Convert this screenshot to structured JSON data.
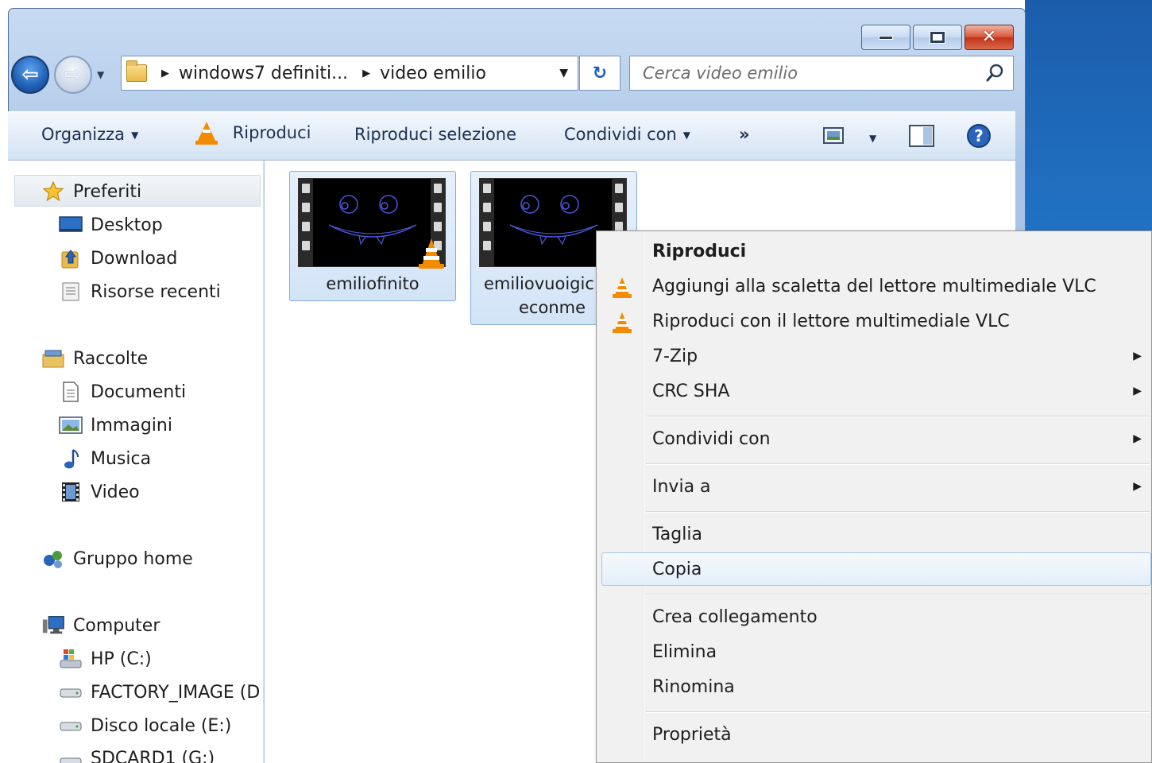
{
  "window": {
    "address": {
      "crumbs": [
        "windows7 definiti...",
        "video emilio"
      ]
    },
    "search": {
      "placeholder": "Cerca video emilio"
    }
  },
  "toolbar": {
    "organizza": "Organizza",
    "riproduci": "Riproduci",
    "riproduci_selezione": "Riproduci selezione",
    "condividi_con": "Condividi con",
    "more": "»"
  },
  "nav": {
    "preferiti": "Preferiti",
    "desktop": "Desktop",
    "download": "Download",
    "risorse_recenti": "Risorse recenti",
    "raccolte": "Raccolte",
    "documenti": "Documenti",
    "immagini": "Immagini",
    "musica": "Musica",
    "video": "Video",
    "gruppo_home": "Gruppo home",
    "computer": "Computer",
    "hp_c": "HP (C:)",
    "factory_image": "FACTORY_IMAGE (D",
    "disco_locale_e": "Disco locale (E:)",
    "sdcard1": "SDCARD1 (G:)"
  },
  "files": [
    {
      "name": "emiliofinito"
    },
    {
      "name_line1": "emiliovuoigic",
      "name_line2": "econme"
    }
  ],
  "context_menu": {
    "riproduci": "Riproduci",
    "aggiungi_vlc": "Aggiungi alla scaletta del lettore multimediale VLC",
    "riproduci_vlc": "Riproduci con il lettore multimediale VLC",
    "seven_zip": "7-Zip",
    "crc_sha": "CRC SHA",
    "condividi_con": "Condividi con",
    "invia_a": "Invia a",
    "taglia": "Taglia",
    "copia": "Copia",
    "crea_collegamento": "Crea collegamento",
    "elimina": "Elimina",
    "rinomina": "Rinomina",
    "proprieta": "Proprietà"
  },
  "colors": {
    "accent": "#1f5fb4",
    "vlc_orange": "#f28b00",
    "menu_bg": "#f1f1f1"
  }
}
